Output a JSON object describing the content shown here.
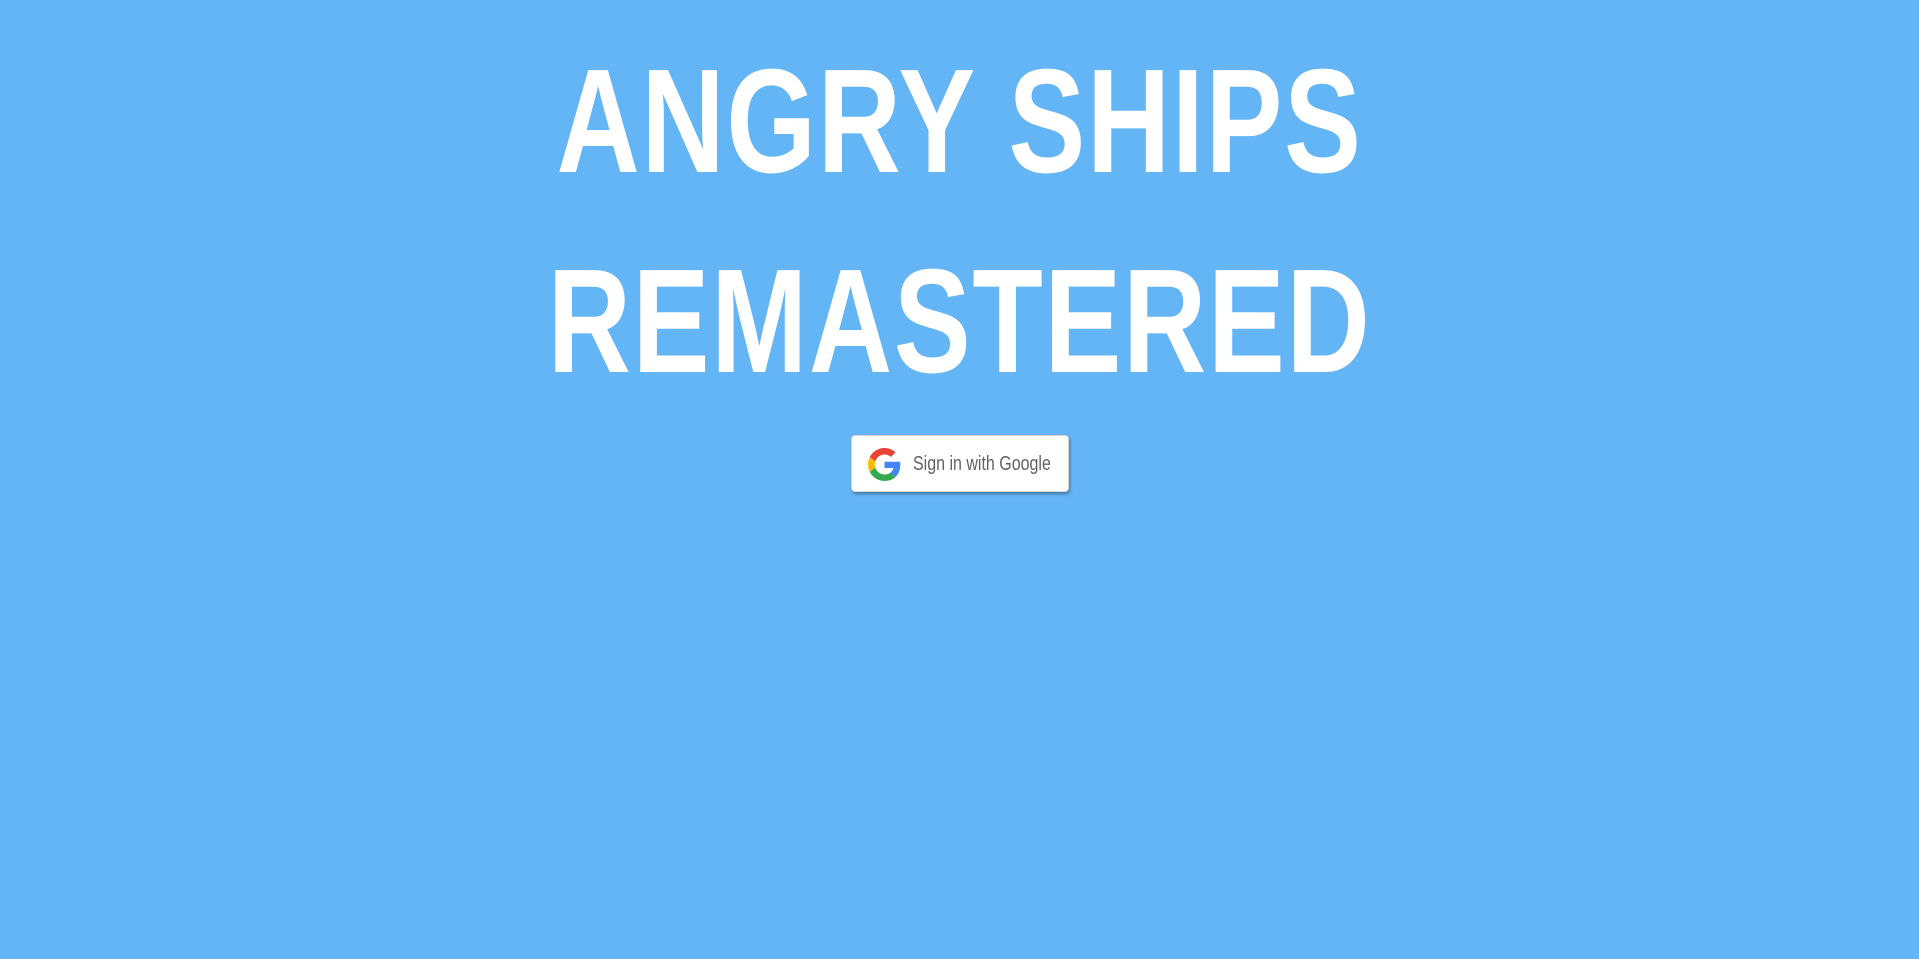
{
  "game": {
    "title_line_1": "ANGRY SHIPS",
    "title_line_2": "REMASTERED"
  },
  "auth": {
    "google_signin_label": "Sign in with Google",
    "google_icon": "google-g-icon"
  },
  "colors": {
    "background": "#64b5f6",
    "title": "#ffffff",
    "button_background": "#ffffff",
    "button_text": "#5f6368"
  }
}
